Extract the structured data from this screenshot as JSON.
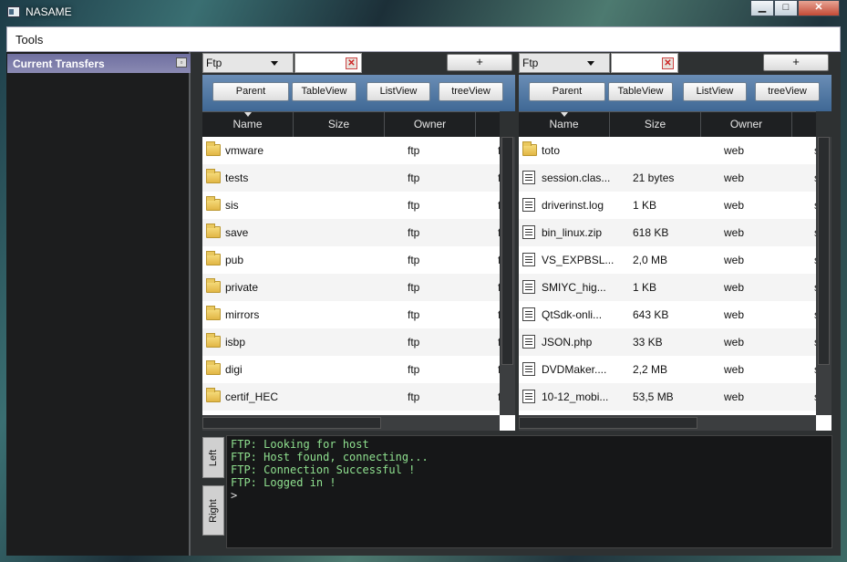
{
  "window": {
    "title": "NASAME",
    "min": "▁",
    "max": "□",
    "close": "✕"
  },
  "menu": {
    "tools": "Tools"
  },
  "transfers": {
    "title": "Current Transfers"
  },
  "left_pane": {
    "protocol": "Ftp",
    "add_label": "+",
    "clear_label": "✕",
    "buttons": [
      "Parent",
      "TableView",
      "ListView",
      "treeView"
    ],
    "columns": [
      "Name",
      "Size",
      "Owner"
    ],
    "rows": [
      {
        "name": "vmware",
        "size": "",
        "owner": "ftp",
        "extra": "f"
      },
      {
        "name": "tests",
        "size": "",
        "owner": "ftp",
        "extra": "f"
      },
      {
        "name": "sis",
        "size": "",
        "owner": "ftp",
        "extra": "f"
      },
      {
        "name": "save",
        "size": "",
        "owner": "ftp",
        "extra": "f"
      },
      {
        "name": "pub",
        "size": "",
        "owner": "ftp",
        "extra": "f"
      },
      {
        "name": "private",
        "size": "",
        "owner": "ftp",
        "extra": "f"
      },
      {
        "name": "mirrors",
        "size": "",
        "owner": "ftp",
        "extra": "f"
      },
      {
        "name": "isbp",
        "size": "",
        "owner": "ftp",
        "extra": "f"
      },
      {
        "name": "digi",
        "size": "",
        "owner": "ftp",
        "extra": "f"
      },
      {
        "name": "certif_HEC",
        "size": "",
        "owner": "ftp",
        "extra": "f"
      }
    ]
  },
  "right_pane": {
    "protocol": "Ftp",
    "add_label": "+",
    "clear_label": "✕",
    "buttons": [
      "Parent",
      "TableView",
      "ListView",
      "treeView"
    ],
    "columns": [
      "Name",
      "Size",
      "Owner"
    ],
    "rows": [
      {
        "name": "toto",
        "size": "",
        "owner": "web",
        "extra": "s",
        "type": "folder"
      },
      {
        "name": "session.clas...",
        "size": "21 bytes",
        "owner": "web",
        "extra": "s",
        "type": "file"
      },
      {
        "name": "driverinst.log",
        "size": "1 KB",
        "owner": "web",
        "extra": "s",
        "type": "file"
      },
      {
        "name": "bin_linux.zip",
        "size": "618 KB",
        "owner": "web",
        "extra": "s",
        "type": "file"
      },
      {
        "name": "VS_EXPBSL...",
        "size": "2,0 MB",
        "owner": "web",
        "extra": "s",
        "type": "file"
      },
      {
        "name": "SMIYC_hig...",
        "size": "1 KB",
        "owner": "web",
        "extra": "s",
        "type": "file"
      },
      {
        "name": "QtSdk-onli...",
        "size": "643 KB",
        "owner": "web",
        "extra": "s",
        "type": "file"
      },
      {
        "name": "JSON.php",
        "size": "33 KB",
        "owner": "web",
        "extra": "s",
        "type": "file"
      },
      {
        "name": "DVDMaker....",
        "size": "2,2 MB",
        "owner": "web",
        "extra": "s",
        "type": "file"
      },
      {
        "name": "10-12_mobi...",
        "size": "53,5 MB",
        "owner": "web",
        "extra": "s",
        "type": "file"
      }
    ]
  },
  "console": {
    "tabs": [
      "Left",
      "Right"
    ],
    "lines": [
      "FTP: Looking for host",
      "FTP: Host found, connecting...",
      "FTP: Connection Successful !",
      "FTP: Logged in !"
    ],
    "prompt": ">"
  }
}
